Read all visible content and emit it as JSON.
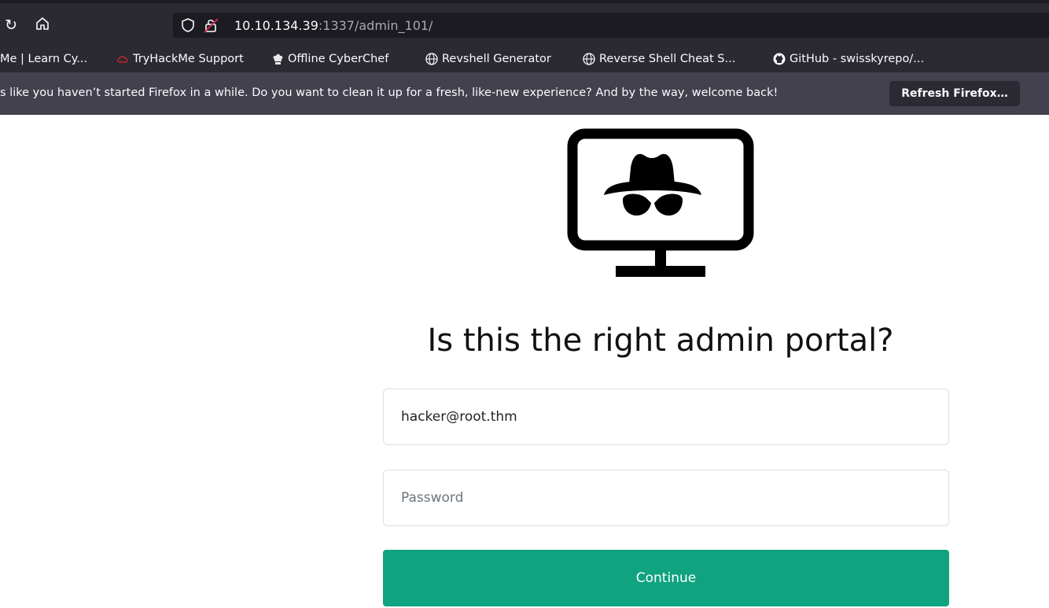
{
  "browser": {
    "url_host": "10.10.134.39",
    "url_rest": ":1337/admin_101/",
    "bookmarks": [
      {
        "label": "Me | Learn Cy...",
        "icon": "none"
      },
      {
        "label": "TryHackMe Support",
        "icon": "thm-cloud-icon"
      },
      {
        "label": "Offline CyberChef",
        "icon": "chef-hat-icon"
      },
      {
        "label": "Revshell Generator",
        "icon": "globe-icon"
      },
      {
        "label": "Reverse Shell Cheat S...",
        "icon": "globe-icon"
      },
      {
        "label": "GitHub - swisskyrepo/...",
        "icon": "github-icon"
      }
    ],
    "notice": {
      "text": "s like you haven’t started Firefox in a while. Do you want to clean it up for a fresh, like-new experience? And by the way, welcome back!",
      "button_label": "Refresh Firefox…"
    }
  },
  "page": {
    "heading": "Is this the right admin portal?",
    "email_value": "hacker@root.thm",
    "password_placeholder": "Password",
    "continue_label": "Continue"
  },
  "colors": {
    "accent": "#10a37f",
    "toolbar": "#2b2a33",
    "notice": "#42414d"
  }
}
